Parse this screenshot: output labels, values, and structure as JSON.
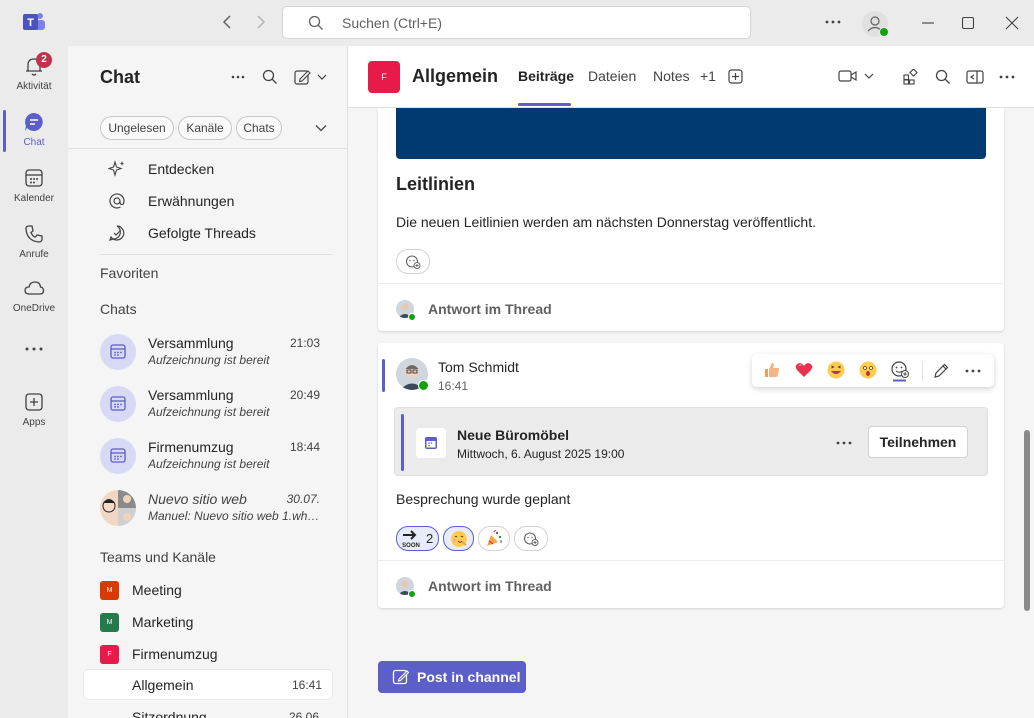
{
  "search": {
    "placeholder": "Suchen (Ctrl+E)"
  },
  "rail": {
    "items": [
      {
        "label": "Aktivität",
        "badge": "2"
      },
      {
        "label": "Chat"
      },
      {
        "label": "Kalender"
      },
      {
        "label": "Anrufe"
      },
      {
        "label": "OneDrive"
      },
      {
        "label": "Apps"
      }
    ]
  },
  "left": {
    "title": "Chat",
    "filters": [
      "Ungelesen",
      "Kanäle",
      "Chats"
    ],
    "nav": [
      "Entdecken",
      "Erwähnungen",
      "Gefolgte Threads"
    ],
    "favorites_label": "Favoriten",
    "chats_label": "Chats",
    "chats": [
      {
        "name": "Versammlung",
        "sub": "Aufzeichnung ist bereit",
        "time": "21:03"
      },
      {
        "name": "Versammlung",
        "sub": "Aufzeichnung ist bereit",
        "time": "20:49"
      },
      {
        "name": "Firmenumzug",
        "sub": "Aufzeichnung ist bereit",
        "time": "18:44"
      },
      {
        "name": "Nuevo sitio web",
        "sub": "Manuel: Nuevo sitio web 1.whit...",
        "time": "30.07."
      }
    ],
    "teams_label": "Teams und Kanäle",
    "teams": [
      {
        "name": "Meeting",
        "initial": "M",
        "color": "#d83b01"
      },
      {
        "name": "Marketing",
        "initial": "M",
        "color": "#237b4b"
      },
      {
        "name": "Firmenumzug",
        "initial": "F",
        "color": "#e81a4a"
      }
    ],
    "channels": [
      {
        "name": "Allgemein",
        "time": "16:41"
      },
      {
        "name": "Sitzordnung",
        "time": "26.06."
      }
    ]
  },
  "header": {
    "avatar_initial": "F",
    "channel": "Allgemein",
    "tabs": [
      "Beiträge",
      "Dateien",
      "Notes",
      "+1"
    ]
  },
  "post1": {
    "title": "Leitlinien",
    "body": "Die neuen Leitlinien werden am nächsten Donnerstag veröffentlicht.",
    "reply_label": "Antwort im Thread",
    "banner_color": "#003a70"
  },
  "post2": {
    "author": "Tom Schmidt",
    "time": "16:41",
    "event_title": "Neue Büromöbel",
    "event_date": "Mittwoch, 6. August 2025 19:00",
    "join_label": "Teilnehmen",
    "body": "Besprechung wurde geplant",
    "reactions": [
      {
        "icon": "soon-icon",
        "count": "2"
      },
      {
        "icon": "smiling-face-icon"
      },
      {
        "icon": "party-popper-icon"
      }
    ],
    "reply_label": "Antwort im Thread"
  },
  "post_button": "Post in channel",
  "colors": {
    "accent": "#5b5fc7",
    "active_tab": "#5b5fc7"
  }
}
